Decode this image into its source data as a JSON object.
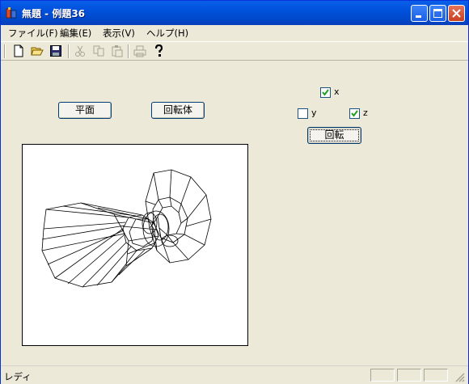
{
  "window": {
    "title": "無題 - 例題36"
  },
  "menu": [
    {
      "label": "ファイル(F)"
    },
    {
      "label": "編集(E)"
    },
    {
      "label": "表示(V)"
    },
    {
      "label": "ヘルプ(H)"
    }
  ],
  "toolbar": {
    "icons": [
      "new-icon",
      "open-icon",
      "save-icon",
      "cut-icon",
      "copy-icon",
      "paste-icon",
      "print-icon",
      "help-icon"
    ],
    "disabled": [
      "cut-icon",
      "copy-icon",
      "paste-icon",
      "print-icon"
    ]
  },
  "buttons": {
    "plane": "平面",
    "rotation_body": "回転体",
    "rotate": "回転"
  },
  "checkboxes": {
    "x": {
      "label": "x",
      "checked": true
    },
    "y": {
      "label": "y",
      "checked": false
    },
    "z": {
      "label": "z",
      "checked": true
    }
  },
  "status": {
    "text": "レディ"
  },
  "colors": {
    "titlebar": "#0054e3",
    "face": "#ece9d8",
    "canvas": "#ffffff"
  }
}
